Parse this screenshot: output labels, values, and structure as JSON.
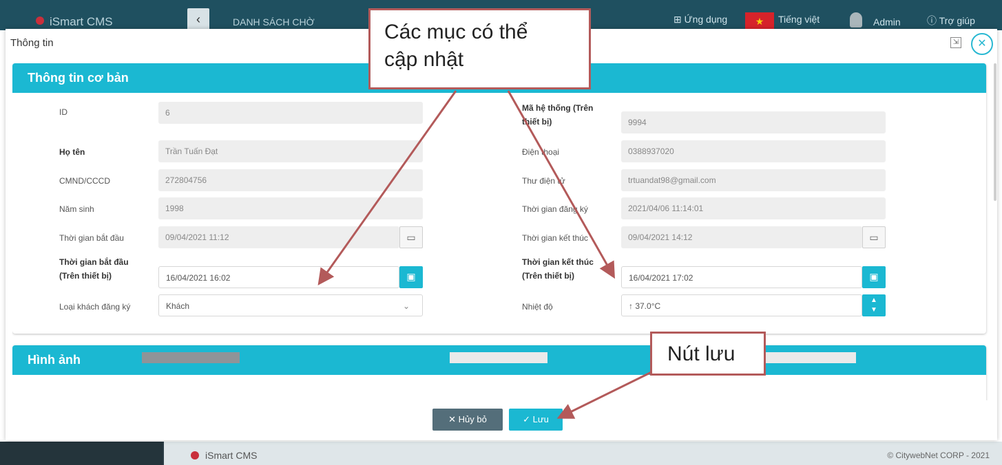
{
  "app": {
    "name": "iSmart CMS",
    "section": "DANH SÁCH CHỜ",
    "apps_label": "Ứng dụng",
    "language": "Tiếng việt",
    "user": "Admin",
    "help": "Trợ giúp",
    "footer_name": "iSmart CMS",
    "copyright": "© CitywebNet CORP - 2021"
  },
  "modal": {
    "title": "Thông tin",
    "basic_section": "Thông tin cơ bản",
    "image_section": "Hình ảnh",
    "left": {
      "id_label": "ID",
      "id_value": "6",
      "name_label": "Họ tên",
      "name_value": "Trần Tuấn Đạt",
      "cmnd_label": "CMND/CCCD",
      "cmnd_value": "272804756",
      "birth_label": "Năm sinh",
      "birth_value": "1998",
      "start_label": "Thời gian bắt đầu",
      "start_value": "09/04/2021 11:12",
      "start_dev_label_1": "Thời gian bắt đầu",
      "start_dev_label_2": "(Trên thiết bị)",
      "start_dev_value": "16/04/2021 16:02",
      "guest_type_label": "Loại khách đăng ký",
      "guest_type_value": "Khách"
    },
    "right": {
      "sys_label_1": "Mã hệ thống (Trên",
      "sys_label_2": "thiết bị)",
      "sys_value": "9994",
      "phone_label": "Điện thoại",
      "phone_value": "0388937020",
      "email_label": "Thư điện tử",
      "email_value": "trtuandat98@gmail.com",
      "reg_label": "Thời gian đăng ký",
      "reg_value": "2021/04/06 11:14:01",
      "end_label": "Thời gian kết thúc",
      "end_value": "09/04/2021 14:12",
      "end_dev_label_1": "Thời gian kết thúc",
      "end_dev_label_2": "(Trên thiết bị)",
      "end_dev_value": "16/04/2021 17:02",
      "temp_label": "Nhiệt độ",
      "temp_value": "↑ 37.0°C"
    },
    "cancel_label": "✕ Hủy bỏ",
    "save_label": "✓ Lưu"
  },
  "annotations": {
    "editable_1": "Các mục có thể",
    "editable_2": "cập nhật",
    "save_button": "Nút lưu"
  },
  "colors": {
    "accent": "#1bb8d2",
    "callout_border": "#b35a5a",
    "cancel": "#546e7a"
  },
  "icons": [
    "back-icon",
    "grid-icon",
    "user-icon",
    "help-icon",
    "maximize-icon",
    "close-icon",
    "calendar-icon",
    "chevron-down-icon",
    "spinner-arrows-icon",
    "x-icon",
    "check-icon"
  ]
}
